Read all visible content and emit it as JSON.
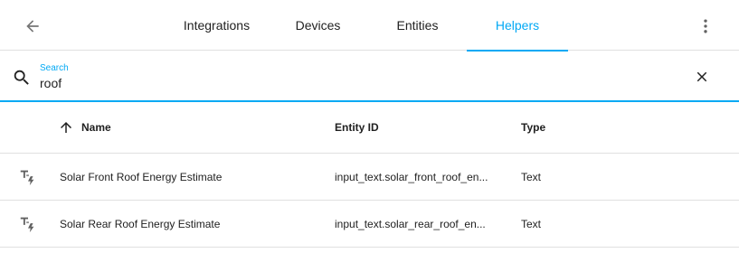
{
  "tabs": [
    {
      "label": "Integrations"
    },
    {
      "label": "Devices"
    },
    {
      "label": "Entities"
    },
    {
      "label": "Helpers"
    }
  ],
  "active_tab": "Helpers",
  "accent_color": "#03a9f4",
  "search": {
    "label": "Search",
    "value": "roof"
  },
  "table": {
    "columns": {
      "name": "Name",
      "entity_id": "Entity ID",
      "type": "Type"
    },
    "rows": [
      {
        "icon": "text-bolt-icon",
        "name": "Solar Front Roof Energy Estimate",
        "entity_id": "input_text.solar_front_roof_en...",
        "type": "Text"
      },
      {
        "icon": "text-bolt-icon",
        "name": "Solar Rear Roof Energy Estimate",
        "entity_id": "input_text.solar_rear_roof_en...",
        "type": "Text"
      }
    ]
  }
}
